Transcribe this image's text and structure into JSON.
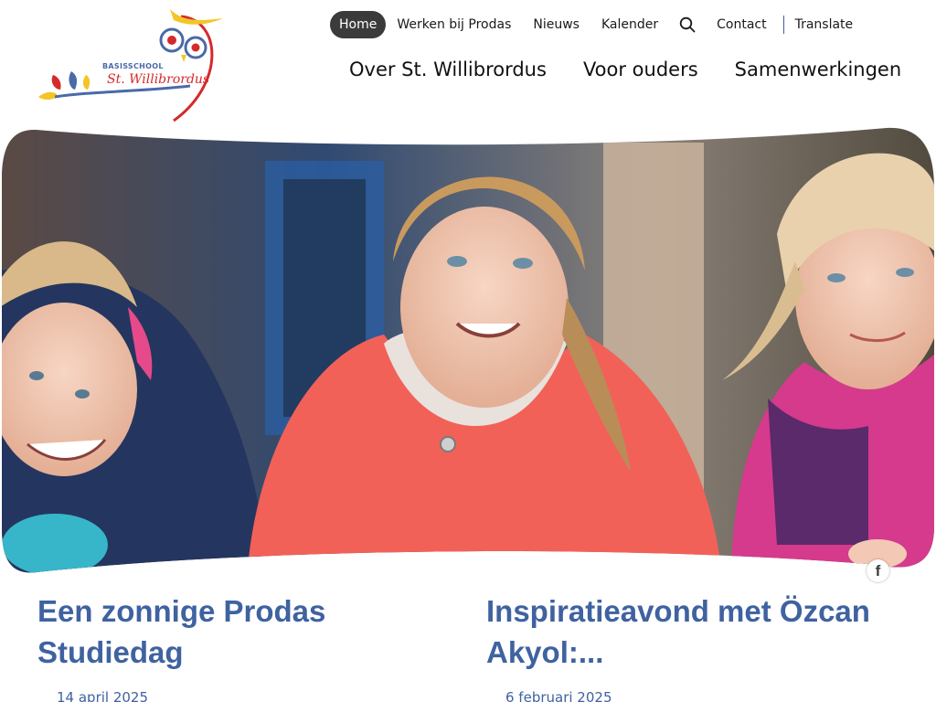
{
  "logo": {
    "school_type": "BASISSCHOOL",
    "school_name": "St. Willibrordus",
    "colors": {
      "blue": "#4a6aa8",
      "red": "#d52a2a",
      "yellow": "#f3c527"
    }
  },
  "top_nav": {
    "items": [
      {
        "label": "Home",
        "active": true
      },
      {
        "label": "Werken bij Prodas"
      },
      {
        "label": "Nieuws"
      },
      {
        "label": "Kalender"
      }
    ],
    "search_icon": "search-icon",
    "contact": "Contact",
    "translate": "Translate",
    "active_bg": "#3b3b3b"
  },
  "main_nav": {
    "items": [
      {
        "label": "Over St. Willibrordus"
      },
      {
        "label": "Voor ouders"
      },
      {
        "label": "Samenwerkingen"
      }
    ]
  },
  "hero": {
    "social_icon": "facebook-icon",
    "social_glyph": "f"
  },
  "news": [
    {
      "title": "Een zonnige Prodas Studiedag",
      "date": "14 april 2025"
    },
    {
      "title": "Inspiratieavond met Özcan Akyol:...",
      "date": "6 februari 2025"
    }
  ],
  "theme": {
    "accent": "#3f62a0"
  }
}
